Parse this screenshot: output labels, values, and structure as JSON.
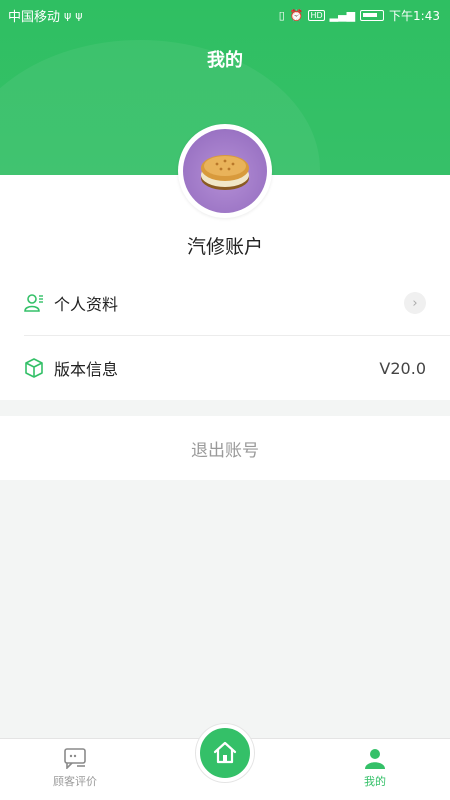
{
  "status_bar": {
    "carrier": "中国移动",
    "time": "下午1:43",
    "network_badge": "HD"
  },
  "header": {
    "title": "我的"
  },
  "profile": {
    "account_name": "汽修账户"
  },
  "menu": {
    "personal_info_label": "个人资料",
    "version_label": "版本信息",
    "version_value": "V20.0"
  },
  "logout_label": "退出账号",
  "tabbar": {
    "reviews_label": "顾客评价",
    "mine_label": "我的"
  },
  "colors": {
    "brand_green": "#34c068",
    "tab_inactive": "#9a9a9a"
  }
}
